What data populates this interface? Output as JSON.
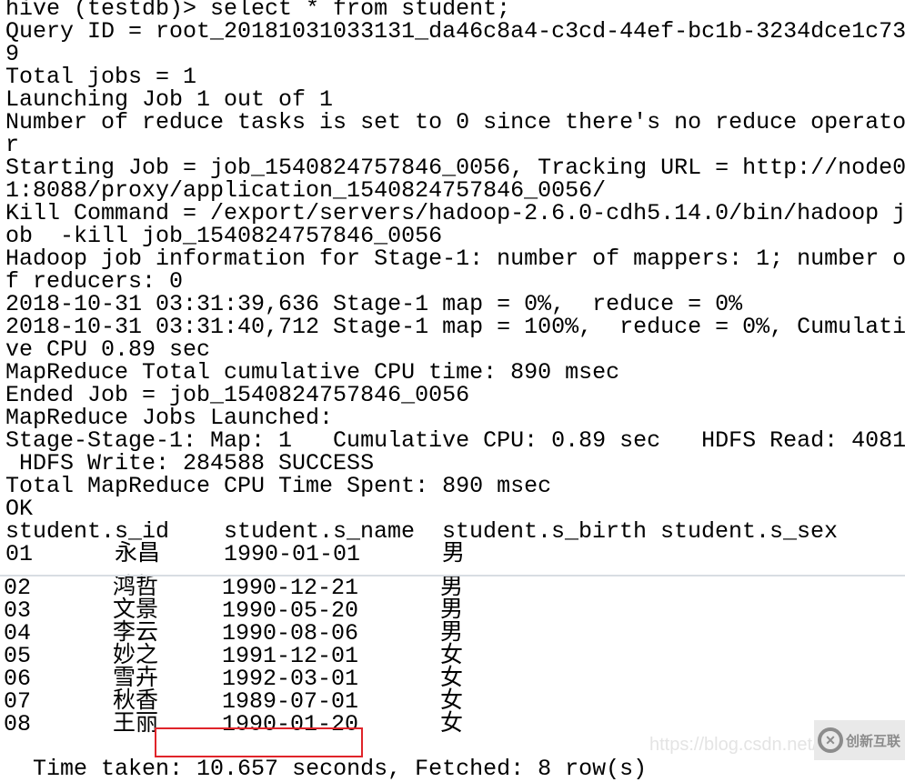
{
  "terminal": {
    "lines": [
      "hive (testdb)> select * from student;",
      "Query ID = root_20181031033131_da46c8a4-c3cd-44ef-bc1b-3234dce1c73",
      "9",
      "Total jobs = 1",
      "Launching Job 1 out of 1",
      "Number of reduce tasks is set to 0 since there's no reduce operato",
      "r",
      "Starting Job = job_1540824757846_0056, Tracking URL = http://node0",
      "1:8088/proxy/application_1540824757846_0056/",
      "Kill Command = /export/servers/hadoop-2.6.0-cdh5.14.0/bin/hadoop j",
      "ob  -kill job_1540824757846_0056",
      "Hadoop job information for Stage-1: number of mappers: 1; number o",
      "f reducers: 0",
      "2018-10-31 03:31:39,636 Stage-1 map = 0%,  reduce = 0%",
      "2018-10-31 03:31:40,712 Stage-1 map = 100%,  reduce = 0%, Cumulati",
      "ve CPU 0.89 sec",
      "MapReduce Total cumulative CPU time: 890 msec",
      "Ended Job = job_1540824757846_0056",
      "MapReduce Jobs Launched:",
      "Stage-Stage-1: Map: 1   Cumulative CPU: 0.89 sec   HDFS Read: 4081",
      " HDFS Write: 284588 SUCCESS",
      "Total MapReduce CPU Time Spent: 890 msec",
      "OK"
    ],
    "table": {
      "headers": [
        "student.s_id",
        "student.s_name",
        "student.s_birth",
        "student.s_sex"
      ],
      "rows": [
        {
          "id": "01",
          "name": "永昌",
          "birth": "1990-01-01",
          "sex": "男"
        },
        {
          "id": "02",
          "name": "鸿哲",
          "birth": "1990-12-21",
          "sex": "男"
        },
        {
          "id": "03",
          "name": "文景",
          "birth": "1990-05-20",
          "sex": "男"
        },
        {
          "id": "04",
          "name": "李云",
          "birth": "1990-08-06",
          "sex": "男"
        },
        {
          "id": "05",
          "name": "妙之",
          "birth": "1991-12-01",
          "sex": "女"
        },
        {
          "id": "06",
          "name": "雪卉",
          "birth": "1992-03-01",
          "sex": "女"
        },
        {
          "id": "07",
          "name": "秋香",
          "birth": "1989-07-01",
          "sex": "女"
        },
        {
          "id": "08",
          "name": "王丽",
          "birth": "1990-01-20",
          "sex": "女"
        }
      ]
    },
    "footer": {
      "prefix": "Time taken: ",
      "highlight": "10.657 seconds",
      "suffix": ", Fetched: 8 row(s)"
    }
  },
  "watermark": {
    "url": "https://blog.csdn.net/weixi",
    "logo_text": "创新互联"
  },
  "colors": {
    "highlight_box": "#e0242a"
  }
}
